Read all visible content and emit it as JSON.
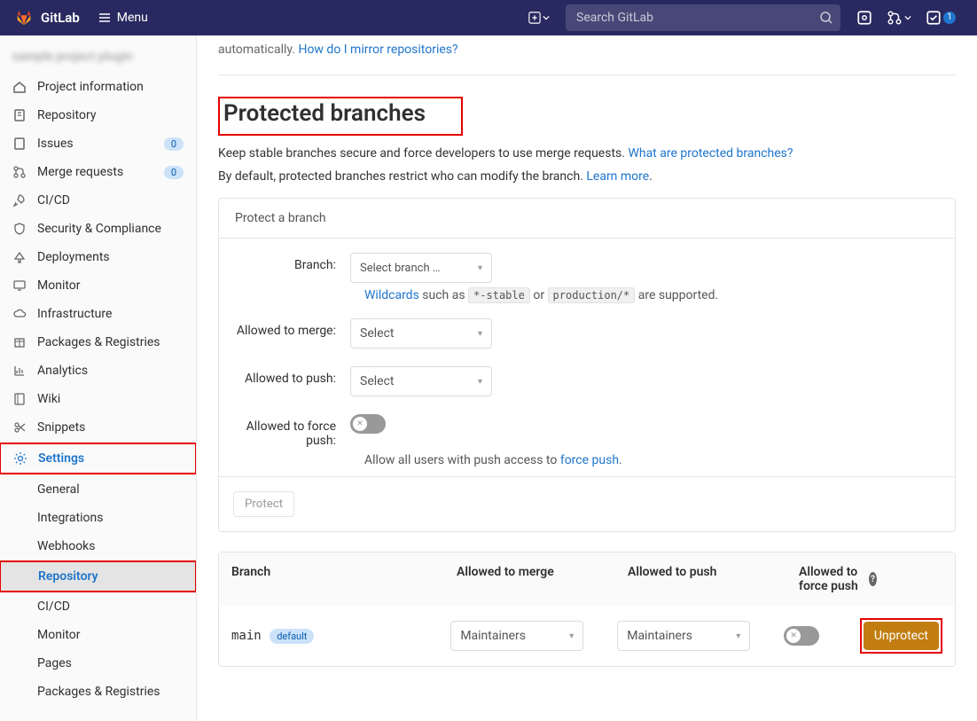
{
  "header": {
    "brand": "GitLab",
    "menu_label": "Menu",
    "search_placeholder": "Search GitLab",
    "todo_count": "1"
  },
  "sidebar": {
    "project_name": "sample project plugin",
    "items": [
      {
        "label": "Project information",
        "badge": ""
      },
      {
        "label": "Repository",
        "badge": ""
      },
      {
        "label": "Issues",
        "badge": "0"
      },
      {
        "label": "Merge requests",
        "badge": "0"
      },
      {
        "label": "CI/CD",
        "badge": ""
      },
      {
        "label": "Security & Compliance",
        "badge": ""
      },
      {
        "label": "Deployments",
        "badge": ""
      },
      {
        "label": "Monitor",
        "badge": ""
      },
      {
        "label": "Infrastructure",
        "badge": ""
      },
      {
        "label": "Packages & Registries",
        "badge": ""
      },
      {
        "label": "Analytics",
        "badge": ""
      },
      {
        "label": "Wiki",
        "badge": ""
      },
      {
        "label": "Snippets",
        "badge": ""
      },
      {
        "label": "Settings",
        "badge": ""
      }
    ],
    "settings_sub": [
      {
        "label": "General"
      },
      {
        "label": "Integrations"
      },
      {
        "label": "Webhooks"
      },
      {
        "label": "Repository"
      },
      {
        "label": "CI/CD"
      },
      {
        "label": "Monitor"
      },
      {
        "label": "Pages"
      },
      {
        "label": "Packages & Registries"
      }
    ]
  },
  "main": {
    "mirror_tail": "automatically. ",
    "mirror_link": "How do I mirror repositories?",
    "section_title": "Protected branches",
    "desc1_pre": "Keep stable branches secure and force developers to use merge requests. ",
    "desc1_link": "What are protected branches?",
    "desc2_pre": "By default, protected branches restrict who can modify the branch. ",
    "desc2_link": "Learn more",
    "desc2_post": ".",
    "panel_header": "Protect a branch",
    "form": {
      "branch_label": "Branch:",
      "branch_select": "Select branch …",
      "wildcards_link": "Wildcards",
      "wildcards_mid": " such as ",
      "wc_ex1": "*-stable",
      "wc_or": " or ",
      "wc_ex2": "production/*",
      "wc_end": " are supported.",
      "merge_label": "Allowed to merge:",
      "merge_select": "Select",
      "push_label": "Allowed to push:",
      "push_select": "Select",
      "force_label": "Allowed to force push:",
      "force_hint_pre": "Allow all users with push access to ",
      "force_hint_link": "force push",
      "force_hint_post": "."
    },
    "protect_btn": "Protect",
    "table": {
      "h_branch": "Branch",
      "h_merge": "Allowed to merge",
      "h_push": "Allowed to push",
      "h_force": "Allowed to force push ",
      "row_branch": "main",
      "row_default": "default",
      "row_merge": "Maintainers",
      "row_push": "Maintainers",
      "unprotect": "Unprotect"
    }
  }
}
